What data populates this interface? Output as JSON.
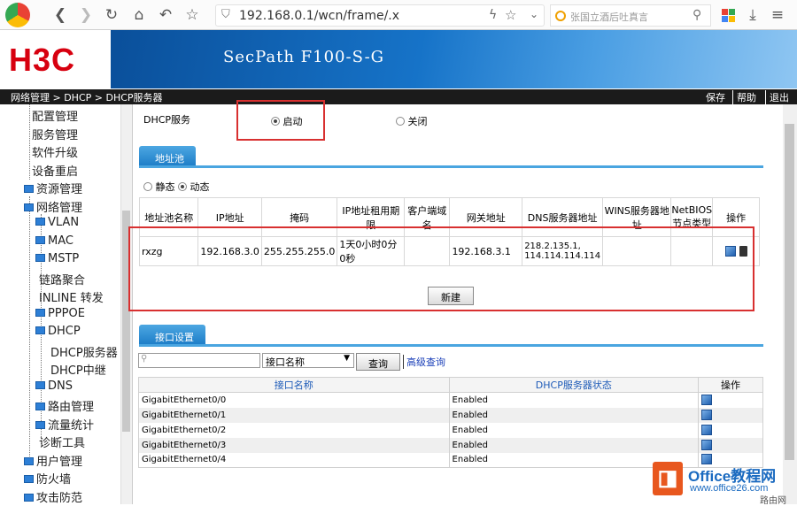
{
  "browser": {
    "url": "192.168.0.1/wcn/frame/.x",
    "search_placeholder": "张国立酒后吐真言"
  },
  "header": {
    "logo": "H3C",
    "product": "SecPath F100-S-G"
  },
  "navbar": {
    "breadcrumb": "网络管理 > DHCP > DHCP服务器",
    "links": [
      "保存",
      "帮助",
      "退出"
    ]
  },
  "sidebar": {
    "items": [
      "配置管理",
      "服务管理",
      "软件升级",
      "设备重启",
      "资源管理",
      "网络管理",
      "VLAN",
      "MAC",
      "MSTP",
      "链路聚合",
      "INLINE 转发",
      "PPPOE",
      "DHCP",
      "DHCP服务器",
      "DHCP中继",
      "DNS",
      "路由管理",
      "流量统计",
      "诊断工具",
      "用户管理",
      "防火墙",
      "攻击防范"
    ]
  },
  "dhcp_service": {
    "label": "DHCP服务",
    "on_label": "启动",
    "off_label": "关闭",
    "selected": "启动"
  },
  "pool_tab": {
    "title": "地址池",
    "mode_static": "静态",
    "mode_dynamic": "动态",
    "selected_mode": "动态",
    "columns": [
      "地址池名称",
      "IP地址",
      "掩码",
      "IP地址租用期限",
      "客户端域名",
      "网关地址",
      "DNS服务器地址",
      "WINS服务器地址",
      "NetBIOS节点类型",
      "操作"
    ],
    "rows": [
      {
        "name": "rxzg",
        "ip": "192.168.3.0",
        "mask": "255.255.255.0",
        "lease": "1天0小时0分0秒",
        "domain": "",
        "gateway": "192.168.3.1",
        "dns": "218.2.135.1, 114.114.114.114",
        "wins": "",
        "netbios": ""
      }
    ],
    "new_button": "新建"
  },
  "iface_tab": {
    "title": "接口设置",
    "search_value": "",
    "filter_select": "接口名称",
    "query_button": "查询",
    "advanced_link": "高级查询",
    "columns": [
      "接口名称",
      "DHCP服务器状态",
      "操作"
    ],
    "rows": [
      {
        "name": "GigabitEthernet0/0",
        "status": "Enabled"
      },
      {
        "name": "GigabitEthernet0/1",
        "status": "Enabled"
      },
      {
        "name": "GigabitEthernet0/2",
        "status": "Enabled"
      },
      {
        "name": "GigabitEthernet0/3",
        "status": "Enabled"
      },
      {
        "name": "GigabitEthernet0/4",
        "status": "Enabled"
      }
    ]
  },
  "watermark": {
    "brand": "Office教程网",
    "url": "www.office26.com",
    "corner": "路由网"
  },
  "colors": {
    "accent": "#1b7bc6",
    "brand_red": "#d7000f",
    "highlight": "#d83030"
  }
}
